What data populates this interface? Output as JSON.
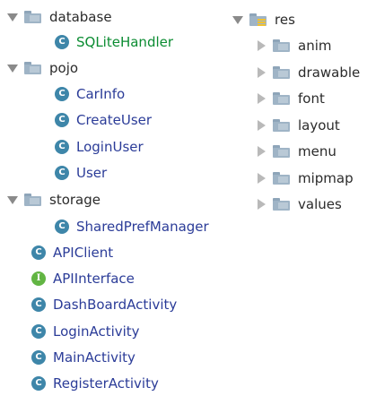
{
  "left_tree": {
    "database": {
      "label": "database",
      "children": [
        "SQLiteHandler"
      ]
    },
    "pojo": {
      "label": "pojo",
      "children": [
        "CarInfo",
        "CreateUser",
        "LoginUser",
        "User"
      ]
    },
    "storage": {
      "label": "storage",
      "children": [
        "SharedPrefManager"
      ]
    },
    "files": [
      {
        "name": "APIClient",
        "badge": "C"
      },
      {
        "name": "APIInterface",
        "badge": "I"
      },
      {
        "name": "DashBoardActivity",
        "badge": "C"
      },
      {
        "name": "LoginActivity",
        "badge": "C"
      },
      {
        "name": "MainActivity",
        "badge": "C"
      },
      {
        "name": "RegisterActivity",
        "badge": "C"
      }
    ]
  },
  "right_tree": {
    "root": "res",
    "folders": [
      "anim",
      "drawable",
      "font",
      "layout",
      "menu",
      "mipmap",
      "values"
    ]
  },
  "icons": {
    "class_badge": "C",
    "interface_badge": "I",
    "class_color": "#3e86a9",
    "interface_color": "#62b543",
    "highlight_text_color": "#0b8c32"
  }
}
